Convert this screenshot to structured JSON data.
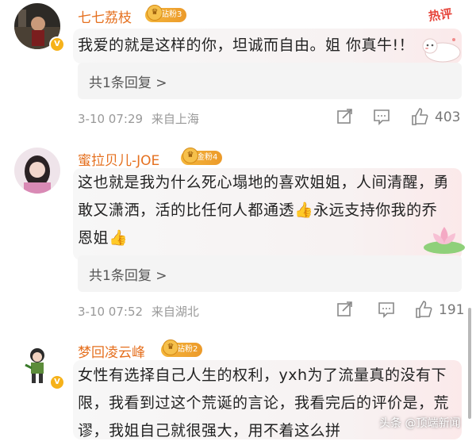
{
  "comments": [
    {
      "username": "七七荔枝",
      "badge": "钻粉3",
      "hot_label": "热评",
      "text": "我爱的就是这样的你，坦诚而自由。姐 你真牛!！",
      "replies_label": "共1条回复 >",
      "time": "3-10 07:29",
      "location": "来自上海",
      "likes": "403"
    },
    {
      "username": "蜜拉贝儿-JOE",
      "badge": "金粉4",
      "text": "这也就是我为什么死心塌地的喜欢姐姐，人间清醒，勇敢又潇洒，活的比任何人都通透👍永远支持你我的乔恩姐👍",
      "replies_label": "共1条回复 >",
      "time": "3-10 07:52",
      "location": "来自湖北",
      "likes": "191"
    },
    {
      "username": "梦回凌云峰",
      "badge": "钻粉2",
      "text": "女性有选择自己人生的权利，yxh为了流量真的没有下限，我看到过这个荒诞的言论，我看完后的评价是，荒谬，我姐自己就很强大，用不着这么拼"
    }
  ],
  "watermark": "头条 @顶端新闻",
  "icons": [
    "share-icon",
    "comment-icon",
    "like-icon"
  ],
  "colors": {
    "username": "#e5701f",
    "hot": "#e6453b",
    "badge": "#f0a832"
  }
}
